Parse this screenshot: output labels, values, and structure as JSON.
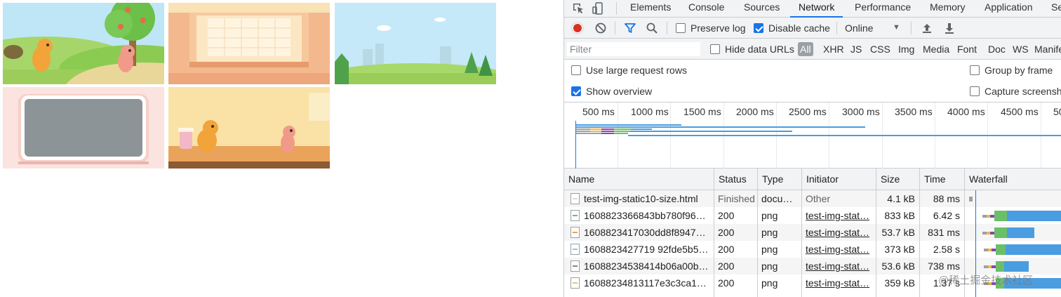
{
  "devtools": {
    "tabs": [
      "Elements",
      "Console",
      "Sources",
      "Network",
      "Performance",
      "Memory",
      "Application",
      "Se"
    ],
    "active_tab": "Network",
    "toolbar": {
      "preserve_log_label": "Preserve log",
      "disable_cache_label": "Disable cache",
      "throttling_value": "Online"
    },
    "filter": {
      "placeholder": "Filter",
      "hide_data_urls_label": "Hide data URLs",
      "types": [
        "All",
        "XHR",
        "JS",
        "CSS",
        "Img",
        "Media",
        "Font",
        "Doc",
        "WS",
        "Manife"
      ]
    },
    "options": {
      "large_rows_label": "Use large request rows",
      "group_by_frame_label": "Group by frame",
      "show_overview_label": "Show overview",
      "capture_screenshots_label": "Capture screensho"
    },
    "overview": {
      "ticks": [
        "500 ms",
        "1000 ms",
        "1500 ms",
        "2000 ms",
        "2500 ms",
        "3000 ms",
        "3500 ms",
        "4000 ms",
        "4500 ms",
        "50"
      ]
    },
    "columns": [
      "Name",
      "Status",
      "Type",
      "Initiator",
      "Size",
      "Time",
      "Waterfall"
    ],
    "requests": [
      {
        "name": "test-img-static10-size.html",
        "status": "Finished",
        "type": "docu…",
        "initiator": "Other",
        "size": "4.1 kB",
        "time": "88 ms"
      },
      {
        "name": "1608823366843bb780f96…",
        "status": "200",
        "type": "png",
        "initiator": "test-img-stat…",
        "size": "833 kB",
        "time": "6.42 s"
      },
      {
        "name": "1608823417030dd8f8947…",
        "status": "200",
        "type": "png",
        "initiator": "test-img-stat…",
        "size": "53.7 kB",
        "time": "831 ms"
      },
      {
        "name": "1608823427719 92fde5b5…",
        "status": "200",
        "type": "png",
        "initiator": "test-img-stat…",
        "size": "373 kB",
        "time": "2.58 s"
      },
      {
        "name": "16088234538414b06a00b…",
        "status": "200",
        "type": "png",
        "initiator": "test-img-stat…",
        "size": "53.6 kB",
        "time": "738 ms"
      },
      {
        "name": "16088234813117e3c3ca1…",
        "status": "200",
        "type": "png",
        "initiator": "test-img-stat…",
        "size": "359 kB",
        "time": "1.37 s"
      }
    ]
  },
  "watermark": "@稀土掘金技术社区",
  "colors": {
    "accent": "#1a73e8",
    "record": "#d93025",
    "waterfall_receive": "#4a9de0",
    "waterfall_wait": "#6abf69"
  }
}
